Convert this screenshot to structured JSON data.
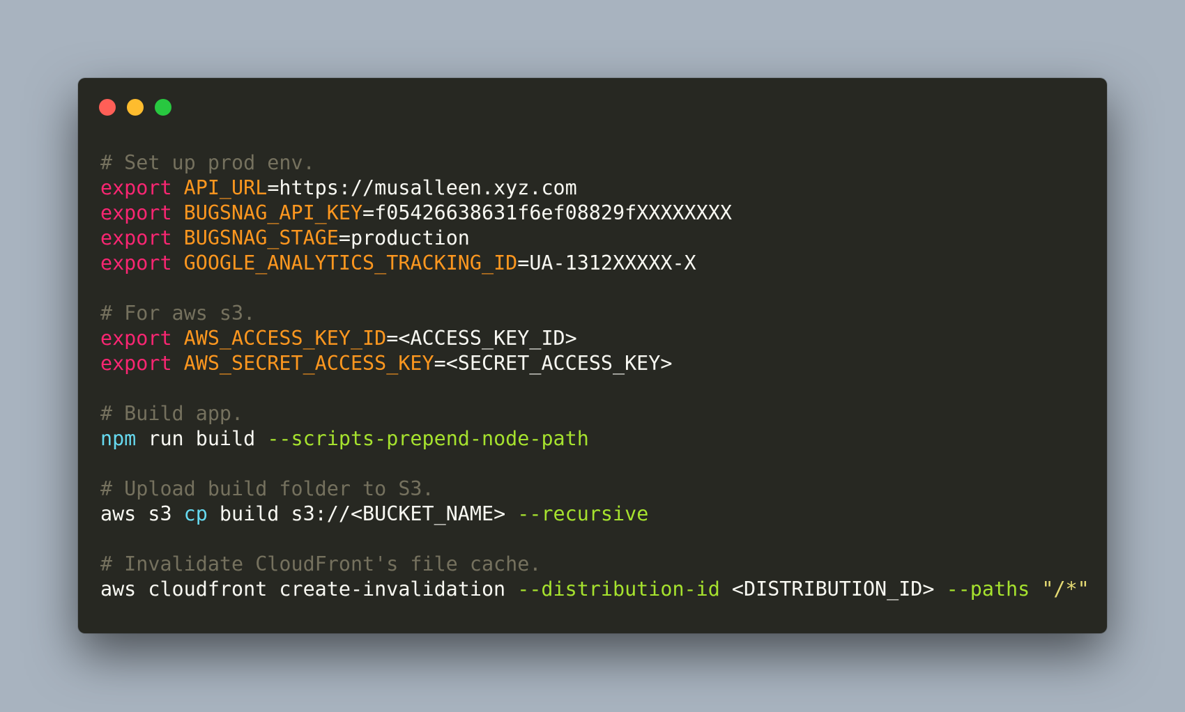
{
  "window": {
    "background": "#272822",
    "traffic_lights": [
      {
        "name": "close",
        "color": "#ff5f57"
      },
      {
        "name": "minimize",
        "color": "#febc2e"
      },
      {
        "name": "zoom",
        "color": "#28c840"
      }
    ]
  },
  "colors": {
    "comment": "#75715e",
    "keyword": "#f92672",
    "variable": "#fd971f",
    "plain": "#f8f8f2",
    "command": "#66d9ef",
    "flag": "#a6e22e",
    "string": "#e6db74"
  },
  "code": {
    "lines": [
      [
        {
          "t": "# Set up prod env.",
          "c": "comment"
        }
      ],
      [
        {
          "t": "export",
          "c": "keyword"
        },
        {
          "t": " ",
          "c": "plain"
        },
        {
          "t": "API_URL",
          "c": "variable"
        },
        {
          "t": "=https://musalleen.xyz.com",
          "c": "plain"
        }
      ],
      [
        {
          "t": "export",
          "c": "keyword"
        },
        {
          "t": " ",
          "c": "plain"
        },
        {
          "t": "BUGSNAG_API_KEY",
          "c": "variable"
        },
        {
          "t": "=f05426638631f6ef08829fXXXXXXXX",
          "c": "plain"
        }
      ],
      [
        {
          "t": "export",
          "c": "keyword"
        },
        {
          "t": " ",
          "c": "plain"
        },
        {
          "t": "BUGSNAG_STAGE",
          "c": "variable"
        },
        {
          "t": "=production",
          "c": "plain"
        }
      ],
      [
        {
          "t": "export",
          "c": "keyword"
        },
        {
          "t": " ",
          "c": "plain"
        },
        {
          "t": "GOOGLE_ANALYTICS_TRACKING_ID",
          "c": "variable"
        },
        {
          "t": "=UA-1312XXXXX-X",
          "c": "plain"
        }
      ],
      [],
      [
        {
          "t": "# For aws s3.",
          "c": "comment"
        }
      ],
      [
        {
          "t": "export",
          "c": "keyword"
        },
        {
          "t": " ",
          "c": "plain"
        },
        {
          "t": "AWS_ACCESS_KEY_ID",
          "c": "variable"
        },
        {
          "t": "=<ACCESS_KEY_ID>",
          "c": "plain"
        }
      ],
      [
        {
          "t": "export",
          "c": "keyword"
        },
        {
          "t": " ",
          "c": "plain"
        },
        {
          "t": "AWS_SECRET_ACCESS_KEY",
          "c": "variable"
        },
        {
          "t": "=<SECRET_ACCESS_KEY>",
          "c": "plain"
        }
      ],
      [],
      [
        {
          "t": "# Build app.",
          "c": "comment"
        }
      ],
      [
        {
          "t": "npm",
          "c": "command"
        },
        {
          "t": " run build ",
          "c": "plain"
        },
        {
          "t": "--scripts-prepend-node-path",
          "c": "flag"
        }
      ],
      [],
      [
        {
          "t": "# Upload build folder to S3.",
          "c": "comment"
        }
      ],
      [
        {
          "t": "aws s3 ",
          "c": "plain"
        },
        {
          "t": "cp",
          "c": "command"
        },
        {
          "t": " build s3://<BUCKET_NAME> ",
          "c": "plain"
        },
        {
          "t": "--recursive",
          "c": "flag"
        }
      ],
      [],
      [
        {
          "t": "# Invalidate CloudFront's file cache.",
          "c": "comment"
        }
      ],
      [
        {
          "t": "aws cloudfront create-invalidation ",
          "c": "plain"
        },
        {
          "t": "--distribution-id",
          "c": "flag"
        },
        {
          "t": " <DISTRIBUTION_ID> ",
          "c": "plain"
        },
        {
          "t": "--paths",
          "c": "flag"
        },
        {
          "t": " ",
          "c": "plain"
        },
        {
          "t": "\"/*\"",
          "c": "string"
        }
      ]
    ]
  }
}
